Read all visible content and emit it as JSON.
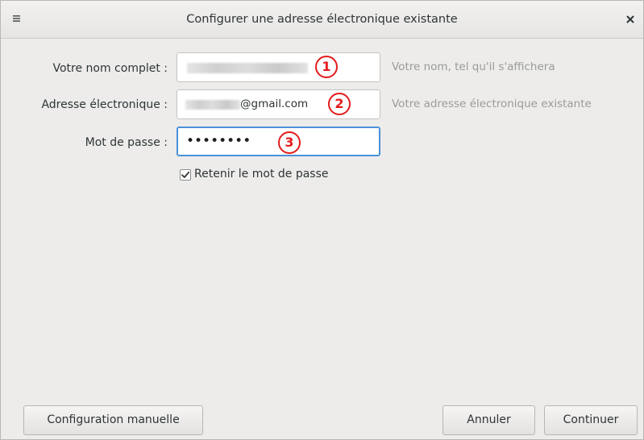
{
  "window": {
    "title": "Configurer une adresse électronique existante"
  },
  "form": {
    "name": {
      "label": "Votre nom complet :",
      "value": "",
      "hint": "Votre nom, tel qu'il s'affichera",
      "badge": "1"
    },
    "email": {
      "label": "Adresse électronique :",
      "value": "@gmail.com",
      "hint": "Votre adresse électronique existante",
      "badge": "2"
    },
    "password": {
      "label": "Mot de passe :",
      "value": "••••••••",
      "badge": "3"
    },
    "remember": {
      "label": "Retenir le mot de passe",
      "checked": true
    }
  },
  "buttons": {
    "manual": "Configuration manuelle",
    "cancel": "Annuler",
    "continue": "Continuer"
  },
  "colors": {
    "badge": "#e41b1b",
    "focus": "#4a90d9",
    "window_bg": "#edeceb"
  },
  "icons": {
    "menu": "hamburger-menu-icon",
    "close": "close-icon",
    "check": "checkmark-icon"
  }
}
